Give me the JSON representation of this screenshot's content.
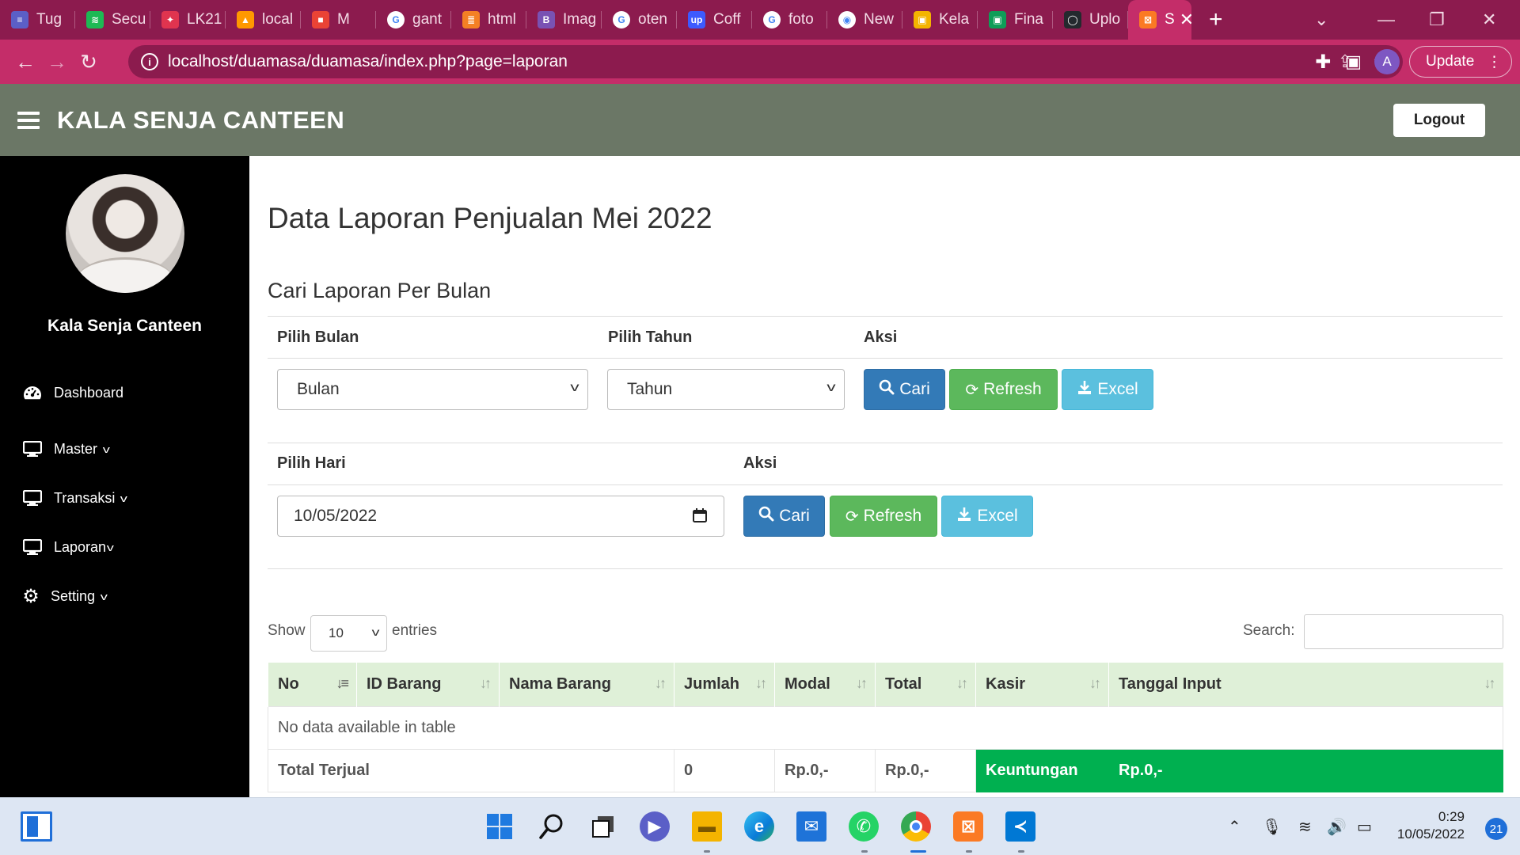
{
  "browser": {
    "tabs": [
      {
        "label": "Tug",
        "fav_color": "#5b5fc7",
        "fav_glyph": "≡"
      },
      {
        "label": "Secu",
        "fav_color": "#1db954",
        "fav_glyph": "≋"
      },
      {
        "label": "LK21",
        "fav_color": "#e0344f",
        "fav_glyph": "✦"
      },
      {
        "label": "local",
        "fav_color": "#ff9800",
        "fav_glyph": "▲"
      },
      {
        "label": "M",
        "fav_color": "#ea4335",
        "fav_glyph": "■"
      },
      {
        "label": "gant",
        "fav_color": "#ffffff",
        "fav_glyph": "G"
      },
      {
        "label": "html",
        "fav_color": "#f48024",
        "fav_glyph": "≣"
      },
      {
        "label": "Imag",
        "fav_color": "#7952b3",
        "fav_glyph": "B"
      },
      {
        "label": "oten",
        "fav_color": "#ffffff",
        "fav_glyph": "G"
      },
      {
        "label": "Coff",
        "fav_color": "#3d5afe",
        "fav_glyph": "up"
      },
      {
        "label": "foto",
        "fav_color": "#ffffff",
        "fav_glyph": "G"
      },
      {
        "label": "New",
        "fav_color": "#ffffff",
        "fav_glyph": "◉"
      },
      {
        "label": "Kela",
        "fav_color": "#f4b400",
        "fav_glyph": "▣"
      },
      {
        "label": "Fina",
        "fav_color": "#0f9d58",
        "fav_glyph": "▣"
      },
      {
        "label": "Uplo",
        "fav_color": "#24292e",
        "fav_glyph": "◯"
      },
      {
        "label": "S",
        "fav_color": "#fb7a24",
        "fav_glyph": "⊠",
        "active": true
      }
    ],
    "new_tab": "+",
    "url": "localhost/duamasa/duamasa/index.php?page=laporan",
    "profile_initial": "A",
    "update_label": "Update"
  },
  "app": {
    "brand": "KALA SENJA CANTEEN",
    "logout_label": "Logout",
    "user_name": "Kala Senja Canteen",
    "menu": [
      {
        "label": "Dashboard",
        "icon": "dashboard-icon",
        "has_caret": false
      },
      {
        "label": "Master",
        "icon": "monitor-icon",
        "has_caret": true
      },
      {
        "label": "Transaksi",
        "icon": "monitor-icon",
        "has_caret": true
      },
      {
        "label": "Laporan",
        "icon": "monitor-icon",
        "has_caret": true
      },
      {
        "label": "Setting",
        "icon": "gear-icon",
        "has_caret": true
      }
    ]
  },
  "page": {
    "title": "Data Laporan Penjualan Mei 2022",
    "subtitle": "Cari Laporan Per Bulan",
    "month_filter": {
      "col_month": "Pilih Bulan",
      "col_year": "Pilih Tahun",
      "col_action": "Aksi",
      "month_value": "Bulan",
      "year_value": "Tahun",
      "btn_search": "Cari",
      "btn_refresh": "Refresh",
      "btn_excel": "Excel"
    },
    "day_filter": {
      "col_day": "Pilih Hari",
      "col_action": "Aksi",
      "date_value": "10/05/2022",
      "btn_search": "Cari",
      "btn_refresh": "Refresh",
      "btn_excel": "Excel"
    },
    "datatable": {
      "show_label": "Show",
      "entries_value": "10",
      "entries_label": "entries",
      "search_label": "Search:",
      "search_value": "",
      "columns": [
        "No",
        "ID Barang",
        "Nama Barang",
        "Jumlah",
        "Modal",
        "Total",
        "Kasir",
        "Tanggal Input"
      ],
      "empty_message": "No data available in table",
      "footer": {
        "label": "Total Terjual",
        "jumlah": "0",
        "modal": "Rp.0,-",
        "total": "Rp.0,-",
        "profit_label": "Keuntungan",
        "profit_value": "Rp.0,-"
      },
      "footer_color": "#00b050",
      "header_color": "#dff0d8"
    }
  },
  "taskbar": {
    "time": "0:29",
    "date": "10/05/2022",
    "notifications": "21"
  }
}
